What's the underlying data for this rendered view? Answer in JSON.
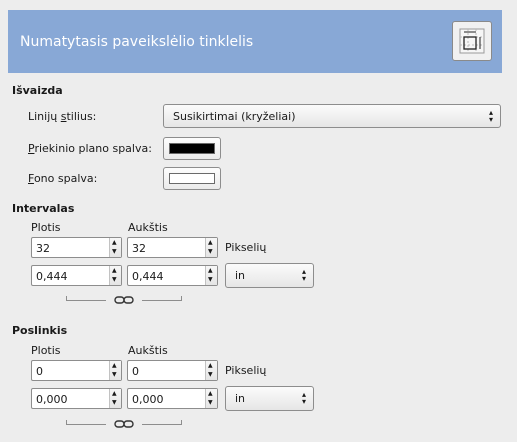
{
  "header": {
    "title": "Numatytasis paveikslėlio tinklelis",
    "icon": "grid-icon"
  },
  "appearance": {
    "section_title": "Išvaizda",
    "line_style_label_pre": "Linijų ",
    "line_style_label_ul": "s",
    "line_style_label_post": "tilius:",
    "line_style_value": "Susikirtimai (kryželiai)",
    "fg_label_ul": "P",
    "fg_label_post": "riekinio plano spalva:",
    "fg_color": "#000000",
    "bg_label_ul": "F",
    "bg_label_post": "ono spalva:",
    "bg_color": "#ffffff"
  },
  "spacing": {
    "section_title": "Intervalas",
    "width_label": "Plotis",
    "height_label": "Aukštis",
    "width_pixels": "32",
    "height_pixels": "32",
    "pixels_unit": "Pikselių",
    "width_units": "0,444",
    "height_units": "0,444",
    "unit_select": "in"
  },
  "offset": {
    "section_title": "Poslinkis",
    "width_label": "Plotis",
    "height_label": "Aukštis",
    "width_pixels": "0",
    "height_pixels": "0",
    "pixels_unit": "Pikselių",
    "width_units": "0,000",
    "height_units": "0,000",
    "unit_select": "in"
  }
}
